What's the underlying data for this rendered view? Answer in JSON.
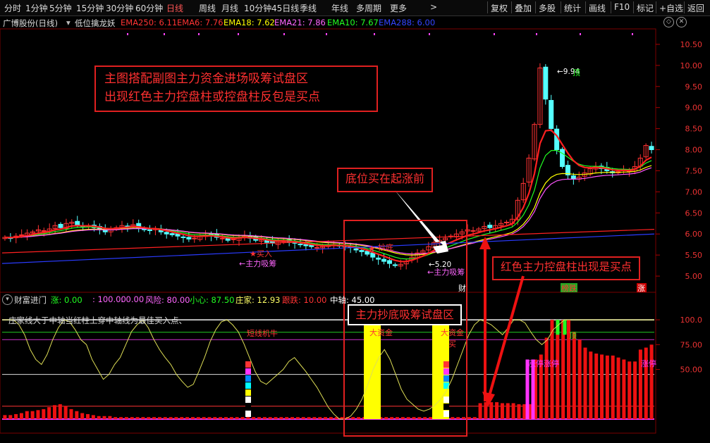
{
  "toolbar": {
    "periods": [
      "分时",
      "1分钟",
      "5分钟",
      "15分钟",
      "30分钟",
      "60分钟",
      "日线",
      "周线",
      "月线",
      "10分钟",
      "45日线",
      "季线",
      "年线",
      "多周期",
      "更多"
    ],
    "active_period": "日线",
    "more_arrow": ">",
    "tools": [
      "复权",
      "叠加",
      "多股",
      "统计",
      "画线",
      "F10",
      "标记",
      "+自选",
      "返回"
    ]
  },
  "main_info": {
    "stock": "广博股份(日线)",
    "indicator": "低位擒龙妖",
    "ema250": "EMA250: 6.11",
    "ema6": "EMA6: 7.76",
    "ema18": "EMA18: 7.62",
    "ema21": "EMA21: 7.86",
    "ema10": "EMA10: 7.67",
    "ema288": "EMA288: 6.00"
  },
  "sub_info": {
    "name": "财富进门",
    "zhang": "涨: 0.00",
    "v100": ": 100.00",
    "v0": ": 0.00",
    "fengxian": "风险: 80.00",
    "xiaoxin": "小心: 87.50",
    "zhuangjia": "庄家: 12.93",
    "gendie": "跟跌: 10.00",
    "zhongzhou": "中轴: 45.00",
    "hint": "庄家线大于中轴当红柱上穿中轴线为最佳买入点、"
  },
  "annotations": {
    "box_main_line1": "主图搭配副图主力资金进场吸筹试盘区",
    "box_main_line2": "出现红色主力控盘柱或控盘柱反包是买点",
    "box_bottom": "底位买在起涨前",
    "box_sub": "主力抄底吸筹试盘区",
    "box_red": "红色主力控盘柱出现是买点"
  },
  "chart_labels": {
    "buy1": "★买入",
    "absorb1": "←主力吸筹",
    "star2": "★",
    "buy2": "抄底",
    "low": "←5.20",
    "absorb2": "←主力吸筹",
    "high": "←9.94",
    "top1": "顶",
    "cai": "财",
    "bangdie": "榜跌",
    "zhang": "涨",
    "duanxian": "短线机牛",
    "dazijin1": "大资金",
    "dazijin2": "大资金",
    "mai": "买",
    "top2": "顶",
    "zhangting": "涨停涨停",
    "zhangting2": "涨停"
  },
  "chart_data": [
    {
      "type": "candlestick",
      "title": "广博股份(日线)",
      "ylim": [
        4.7,
        10.8
      ],
      "y_ticks": [
        5.0,
        5.5,
        6.0,
        6.5,
        7.0,
        7.5,
        8.0,
        8.5,
        9.0,
        9.5,
        10.0,
        10.5
      ],
      "closes": [
        5.92,
        5.9,
        5.95,
        5.98,
        6.02,
        6.05,
        6.1,
        6.08,
        6.12,
        6.2,
        6.15,
        6.25,
        6.28,
        6.22,
        6.18,
        6.2,
        6.15,
        6.12,
        6.05,
        6.1,
        6.15,
        6.2,
        6.18,
        6.22,
        6.15,
        6.1,
        6.08,
        6.12,
        6.05,
        6.0,
        5.98,
        5.95,
        5.92,
        5.88,
        5.9,
        5.95,
        5.98,
        5.96,
        5.92,
        5.9,
        5.85,
        5.88,
        5.92,
        5.95,
        5.9,
        5.85,
        5.86,
        5.8,
        5.78,
        5.82,
        5.85,
        5.8,
        5.78,
        5.75,
        5.72,
        5.7,
        5.68,
        5.7,
        5.72,
        5.75,
        5.72,
        5.7,
        5.68,
        5.62,
        5.58,
        5.52,
        5.45,
        5.4,
        5.35,
        5.3,
        5.25,
        5.28,
        5.35,
        5.45,
        5.55,
        5.6,
        5.7,
        5.8,
        5.85,
        5.9,
        5.95,
        6.0,
        6.05,
        6.1,
        6.08,
        6.12,
        6.18,
        6.15,
        6.2,
        6.25,
        6.28,
        6.35,
        6.8,
        7.2,
        7.8,
        8.6,
        9.94,
        9.2,
        8.5,
        8.0,
        7.6,
        7.4,
        7.3,
        7.35,
        7.45,
        7.55,
        7.6,
        7.55,
        7.5,
        7.45,
        7.48,
        7.52,
        7.5,
        7.6,
        7.8,
        8.1,
        8.0
      ]
    },
    {
      "type": "bar",
      "title": "财富进门",
      "ylim": [
        0,
        110
      ],
      "y_ticks": [
        50.0,
        75.0,
        100.0
      ],
      "reference_lines": [
        100,
        87.5,
        80,
        45
      ],
      "zhuangjia_line": [
        100,
        100,
        100,
        95,
        85,
        70,
        60,
        55,
        65,
        80,
        92,
        100,
        98,
        90,
        80,
        75,
        60,
        50,
        40,
        45,
        55,
        62,
        75,
        88,
        95,
        100,
        92,
        80,
        70,
        62,
        55,
        45,
        38,
        32,
        35,
        48,
        62,
        78,
        90,
        98,
        100,
        95,
        88,
        76,
        62,
        48,
        38,
        35,
        40,
        45,
        50,
        58,
        62,
        55,
        48,
        40,
        32,
        22,
        12,
        5,
        0,
        0,
        3,
        10,
        20,
        34,
        50,
        62,
        70,
        60,
        45,
        30,
        20,
        15,
        10,
        8,
        10,
        14,
        20,
        28,
        40,
        55,
        70,
        85,
        95,
        100,
        98,
        95,
        90,
        85,
        92,
        100,
        100,
        97,
        88,
        80,
        75,
        80,
        90,
        95,
        100,
        100,
        100,
        100,
        100,
        100,
        100,
        100,
        100,
        100,
        100,
        100,
        100,
        100,
        100,
        100,
        100
      ],
      "zhuangjia_value": 12.93,
      "red_bar_values": [
        4,
        4,
        5,
        6,
        8,
        8,
        9,
        10,
        12,
        14,
        15,
        13,
        10,
        8,
        6,
        5,
        4,
        3,
        3,
        3,
        2,
        2,
        2,
        2,
        2,
        2,
        2,
        2,
        2,
        2,
        2,
        2,
        2,
        2,
        2,
        2,
        2,
        2,
        2,
        2,
        2,
        2,
        2,
        2,
        2,
        2,
        2,
        2,
        2,
        2,
        2,
        2,
        2,
        2,
        2,
        2,
        2,
        2,
        2,
        2,
        2,
        2,
        2,
        2,
        2,
        2,
        2,
        2,
        2,
        2,
        2,
        2,
        2,
        2,
        2,
        2,
        2,
        2,
        2,
        2,
        2,
        2,
        2,
        2,
        2,
        2,
        16,
        17,
        17,
        17,
        16,
        16,
        16,
        15,
        15,
        15,
        60,
        65,
        82,
        100,
        100,
        100,
        100,
        88,
        80,
        72,
        68,
        66,
        65,
        64,
        64,
        62,
        60,
        58,
        58,
        70,
        72,
        75
      ]
    }
  ],
  "colors": {
    "up": "#ff3333",
    "down": "#55ffff",
    "ema_red": "#ff2020",
    "ema_blue": "#2a3bff",
    "ema_yellow": "#ffff00",
    "ema_green": "#22ff22",
    "ema_magenta": "#ff55ff",
    "annotation": "#ff2a2a"
  }
}
